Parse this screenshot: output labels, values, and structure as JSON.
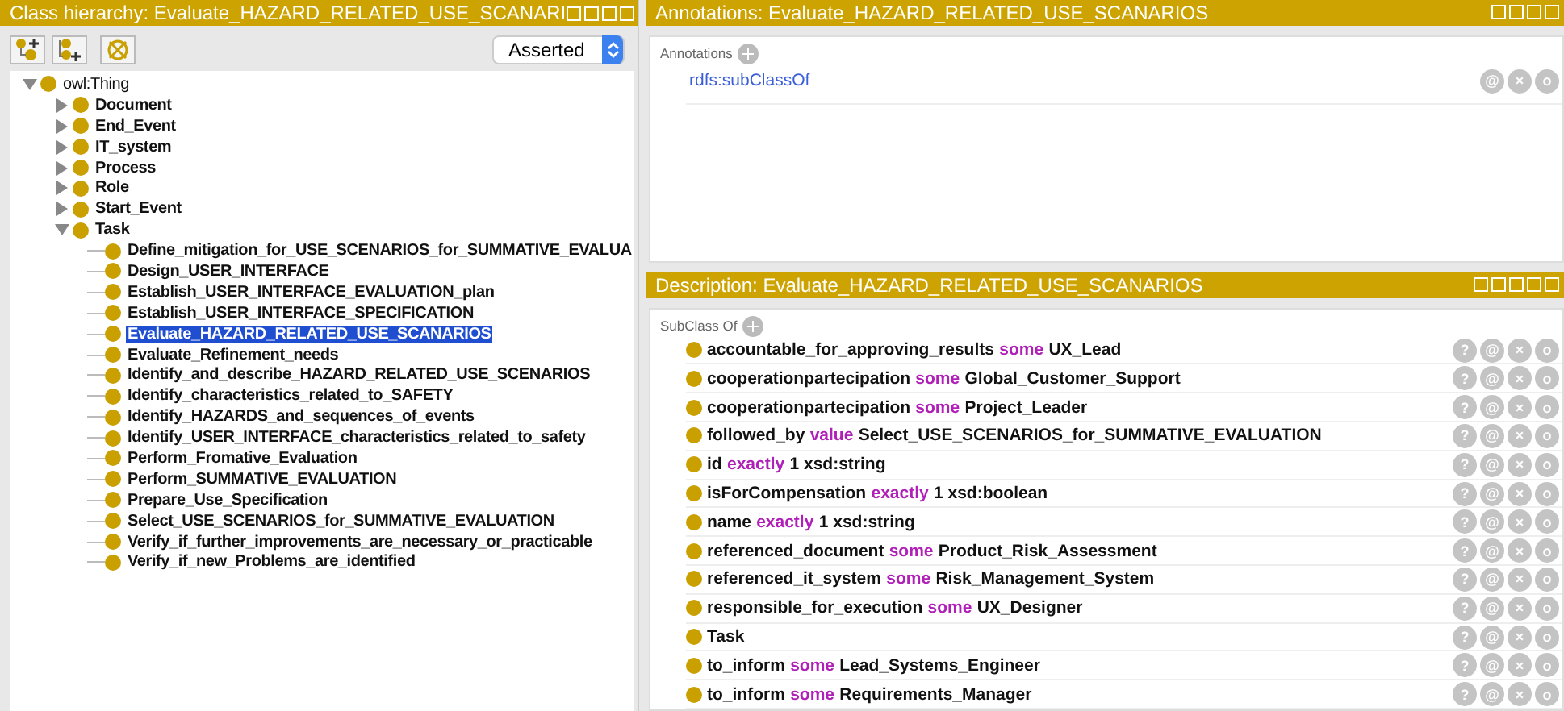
{
  "class_hierarchy": {
    "title": "Class hierarchy: Evaluate_HAZARD_RELATED_USE_SCANARI",
    "view_select": {
      "value": "Asserted"
    },
    "tree": [
      {
        "label": "owl:Thing",
        "expanded": true,
        "selected": false,
        "children": [
          {
            "label": "Document",
            "expanded": false,
            "selected": false
          },
          {
            "label": "End_Event",
            "expanded": false,
            "selected": false
          },
          {
            "label": "IT_system",
            "expanded": false,
            "selected": false
          },
          {
            "label": "Process",
            "expanded": false,
            "selected": false
          },
          {
            "label": "Role",
            "expanded": false,
            "selected": false
          },
          {
            "label": "Start_Event",
            "expanded": false,
            "selected": false
          },
          {
            "label": "Task",
            "expanded": true,
            "selected": false,
            "children": [
              {
                "label": "Define_mitigation_for_USE_SCENARIOS_for_SUMMATIVE_EVALUA",
                "selected": false
              },
              {
                "label": "Design_USER_INTERFACE",
                "selected": false
              },
              {
                "label": "Establish_USER_INTERFACE_EVALUATION_plan",
                "selected": false
              },
              {
                "label": "Establish_USER_INTERFACE_SPECIFICATION",
                "selected": false
              },
              {
                "label": "Evaluate_HAZARD_RELATED_USE_SCANARIOS",
                "selected": true
              },
              {
                "label": "Evaluate_Refinement_needs",
                "selected": false
              },
              {
                "label": "Identify_and_describe_HAZARD_RELATED_USE_SCENARIOS",
                "selected": false
              },
              {
                "label": "Identify_characteristics_related_to_SAFETY",
                "selected": false
              },
              {
                "label": "Identify_HAZARDS_and_sequences_of_events",
                "selected": false
              },
              {
                "label": "Identify_USER_INTERFACE_characteristics_related_to_safety",
                "selected": false
              },
              {
                "label": "Perform_Fromative_Evaluation",
                "selected": false
              },
              {
                "label": "Perform_SUMMATIVE_EVALUATION",
                "selected": false
              },
              {
                "label": "Prepare_Use_Specification",
                "selected": false
              },
              {
                "label": "Select_USE_SCENARIOS_for_SUMMATIVE_EVALUATION",
                "selected": false
              },
              {
                "label": "Verify_if_further_improvements_are_necessary_or_practicable",
                "selected": false
              },
              {
                "label": "Verify_if_new_Problems_are_identified",
                "selected": false
              }
            ]
          }
        ]
      }
    ]
  },
  "annotations": {
    "title": "Annotations: Evaluate_HAZARD_RELATED_USE_SCANARIOS",
    "section": "Annotations",
    "rows": [
      {
        "text": "rdfs:subClassOf",
        "buttons": [
          "@",
          "×",
          "o"
        ]
      }
    ]
  },
  "description": {
    "title": "Description: Evaluate_HAZARD_RELATED_USE_SCANARIOS",
    "section": "SubClass Of",
    "rows": [
      {
        "property": "accountable_for_approving_results",
        "keyword": "some",
        "filler": "UX_Lead",
        "buttons": [
          "?",
          "@",
          "×",
          "o"
        ]
      },
      {
        "property": "cooperationpartecipation",
        "keyword": "some",
        "filler": "Global_Customer_Support",
        "buttons": [
          "?",
          "@",
          "×",
          "o"
        ]
      },
      {
        "property": "cooperationpartecipation",
        "keyword": "some",
        "filler": "Project_Leader",
        "buttons": [
          "?",
          "@",
          "×",
          "o"
        ]
      },
      {
        "property": "followed_by",
        "keyword": "value",
        "filler": "Select_USE_SCENARIOS_for_SUMMATIVE_EVALUATION",
        "buttons": [
          "?",
          "@",
          "×",
          "o"
        ]
      },
      {
        "property": "id",
        "keyword": "exactly",
        "filler": "1 xsd:string",
        "buttons": [
          "?",
          "@",
          "×",
          "o"
        ]
      },
      {
        "property": "isForCompensation",
        "keyword": "exactly",
        "filler": "1 xsd:boolean",
        "buttons": [
          "?",
          "@",
          "×",
          "o"
        ]
      },
      {
        "property": "name",
        "keyword": "exactly",
        "filler": "1 xsd:string",
        "buttons": [
          "?",
          "@",
          "×",
          "o"
        ]
      },
      {
        "property": "referenced_document",
        "keyword": "some",
        "filler": "Product_Risk_Assessment",
        "buttons": [
          "?",
          "@",
          "×",
          "o"
        ]
      },
      {
        "property": "referenced_it_system",
        "keyword": "some",
        "filler": "Risk_Management_System",
        "buttons": [
          "?",
          "@",
          "×",
          "o"
        ]
      },
      {
        "property": "responsible_for_execution",
        "keyword": "some",
        "filler": "UX_Designer",
        "buttons": [
          "?",
          "@",
          "×",
          "o"
        ]
      },
      {
        "filler": "Task",
        "buttons": [
          "?",
          "@",
          "×",
          "o"
        ]
      },
      {
        "property": "to_inform",
        "keyword": "some",
        "filler": "Lead_Systems_Engineer",
        "buttons": [
          "?",
          "@",
          "×",
          "o"
        ]
      },
      {
        "property": "to_inform",
        "keyword": "some",
        "filler": "Requirements_Manager",
        "buttons": [
          "?",
          "@",
          "×",
          "o"
        ]
      }
    ]
  }
}
